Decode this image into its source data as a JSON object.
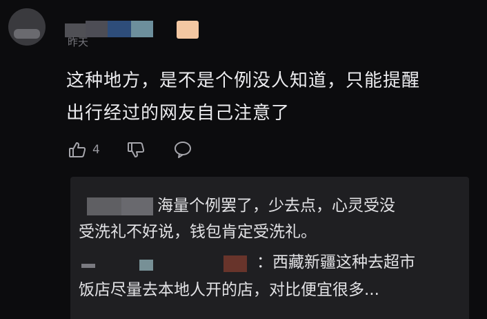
{
  "comment": {
    "timestamp": "昨天",
    "text_line1": "这种地方，是不是个例没人知道，只能提醒",
    "text_line2": "出行经过的网友自己注意了",
    "like_count": "4"
  },
  "replies": [
    {
      "text_line1": "海量个例罢了，少去点，心灵受没",
      "text_line2": "受洗礼不好说，钱包肯定受洗礼。"
    },
    {
      "text_line1": "：西藏新疆这种去超市",
      "text_line2": "饭店尽量去本地人开的店，对比便宜很多..."
    }
  ],
  "icons": [
    "thumbs-up-icon",
    "thumbs-down-icon",
    "reply-bubble-icon"
  ],
  "colors": {
    "background": "#0c0c0e",
    "reply_panel": "#1f1f22",
    "text": "#ececef",
    "muted": "#76767c"
  }
}
